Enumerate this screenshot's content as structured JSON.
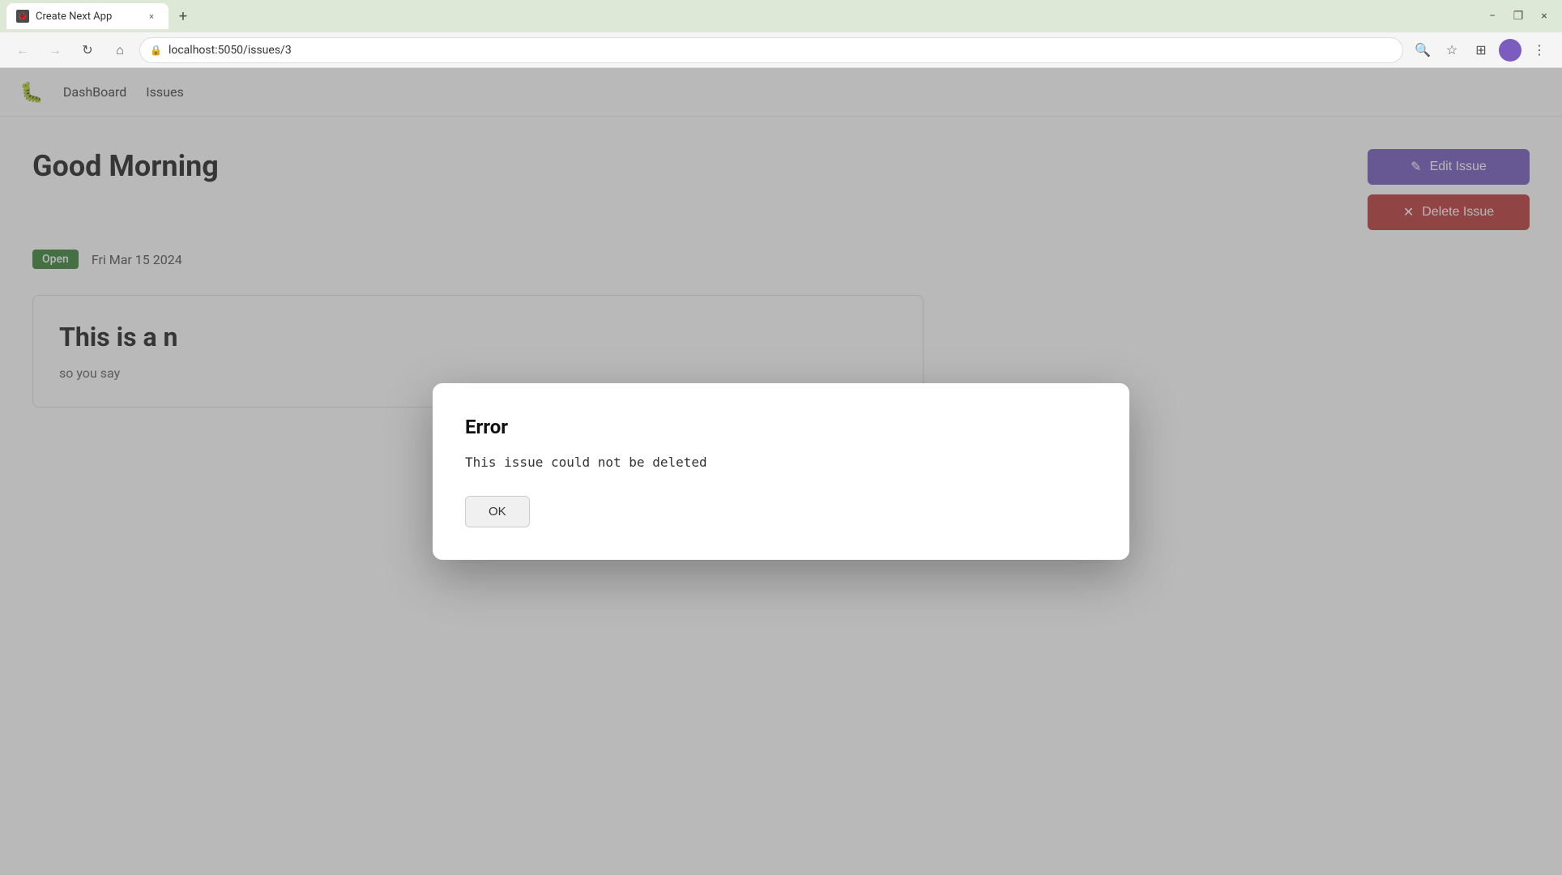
{
  "browser": {
    "tab_title": "Create Next App",
    "url": "localhost:5050/issues/3",
    "favicon_symbol": "🐞"
  },
  "nav": {
    "logo_symbol": "🐛",
    "links": [
      {
        "label": "DashBoard",
        "href": "#"
      },
      {
        "label": "Issues",
        "href": "#"
      }
    ]
  },
  "page": {
    "greeting": "Good Morning",
    "status_label": "Open",
    "date_label": "Fri Mar 15 2024",
    "edit_button_label": "Edit Issue",
    "delete_button_label": "Delete Issue",
    "issue_title": "This is a n",
    "issue_body": "so you say"
  },
  "modal": {
    "title": "Error",
    "message": "This issue could not be deleted",
    "ok_button_label": "OK"
  },
  "icons": {
    "edit": "✎",
    "delete": "✕",
    "search": "🔍",
    "star": "☆",
    "extensions": "⊞",
    "profile": "👤",
    "menu": "⋮",
    "back": "←",
    "forward": "→",
    "reload": "↻",
    "home": "⌂",
    "zoom": "🔍",
    "close": "×",
    "minimize": "−",
    "restore": "❐",
    "new_tab": "+"
  }
}
